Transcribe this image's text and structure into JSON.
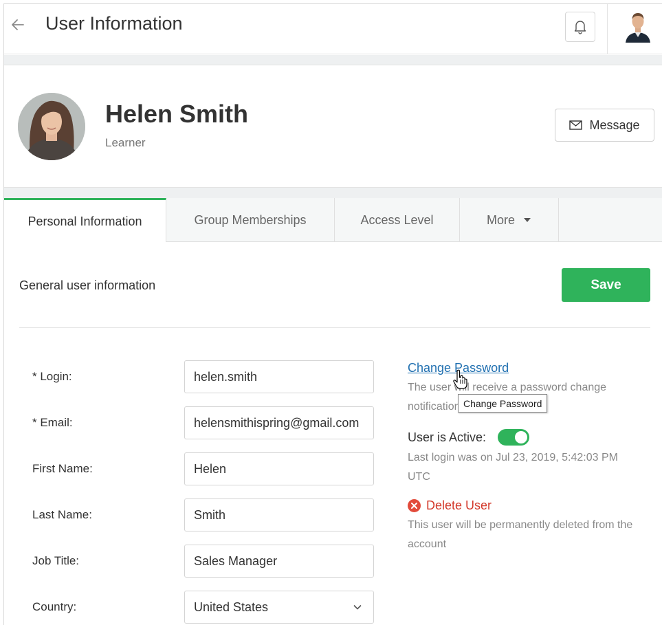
{
  "header": {
    "title": "User Information"
  },
  "profile": {
    "name": "Helen Smith",
    "role": "Learner",
    "message_label": "Message"
  },
  "tabs": [
    {
      "label": "Personal Information",
      "active": true
    },
    {
      "label": "Group Memberships",
      "active": false
    },
    {
      "label": "Access Level",
      "active": false
    },
    {
      "label": "More",
      "active": false
    }
  ],
  "section": {
    "title": "General user information",
    "save_label": "Save"
  },
  "form": {
    "fields": [
      {
        "label": "* Login:",
        "value": "helen.smith"
      },
      {
        "label": "* Email:",
        "value": "helensmithispring@gmail.com"
      },
      {
        "label": "First Name:",
        "value": "Helen"
      },
      {
        "label": "Last Name:",
        "value": "Smith"
      },
      {
        "label": "Job Title:",
        "value": "Sales Manager"
      },
      {
        "label": "Country:",
        "value": "United States"
      }
    ]
  },
  "side": {
    "change_password": "Change Password",
    "change_password_help": "The user will receive a password change notification",
    "tooltip": "Change Password",
    "active_label": "User is Active:",
    "active": true,
    "last_login": "Last login was on Jul 23, 2019, 5:42:03 PM UTC",
    "delete_label": "Delete User",
    "delete_help": "This user will be permanently deleted from the account"
  },
  "colors": {
    "accent": "#2fb35b",
    "link": "#1f6fb0",
    "danger": "#e24b3b"
  }
}
